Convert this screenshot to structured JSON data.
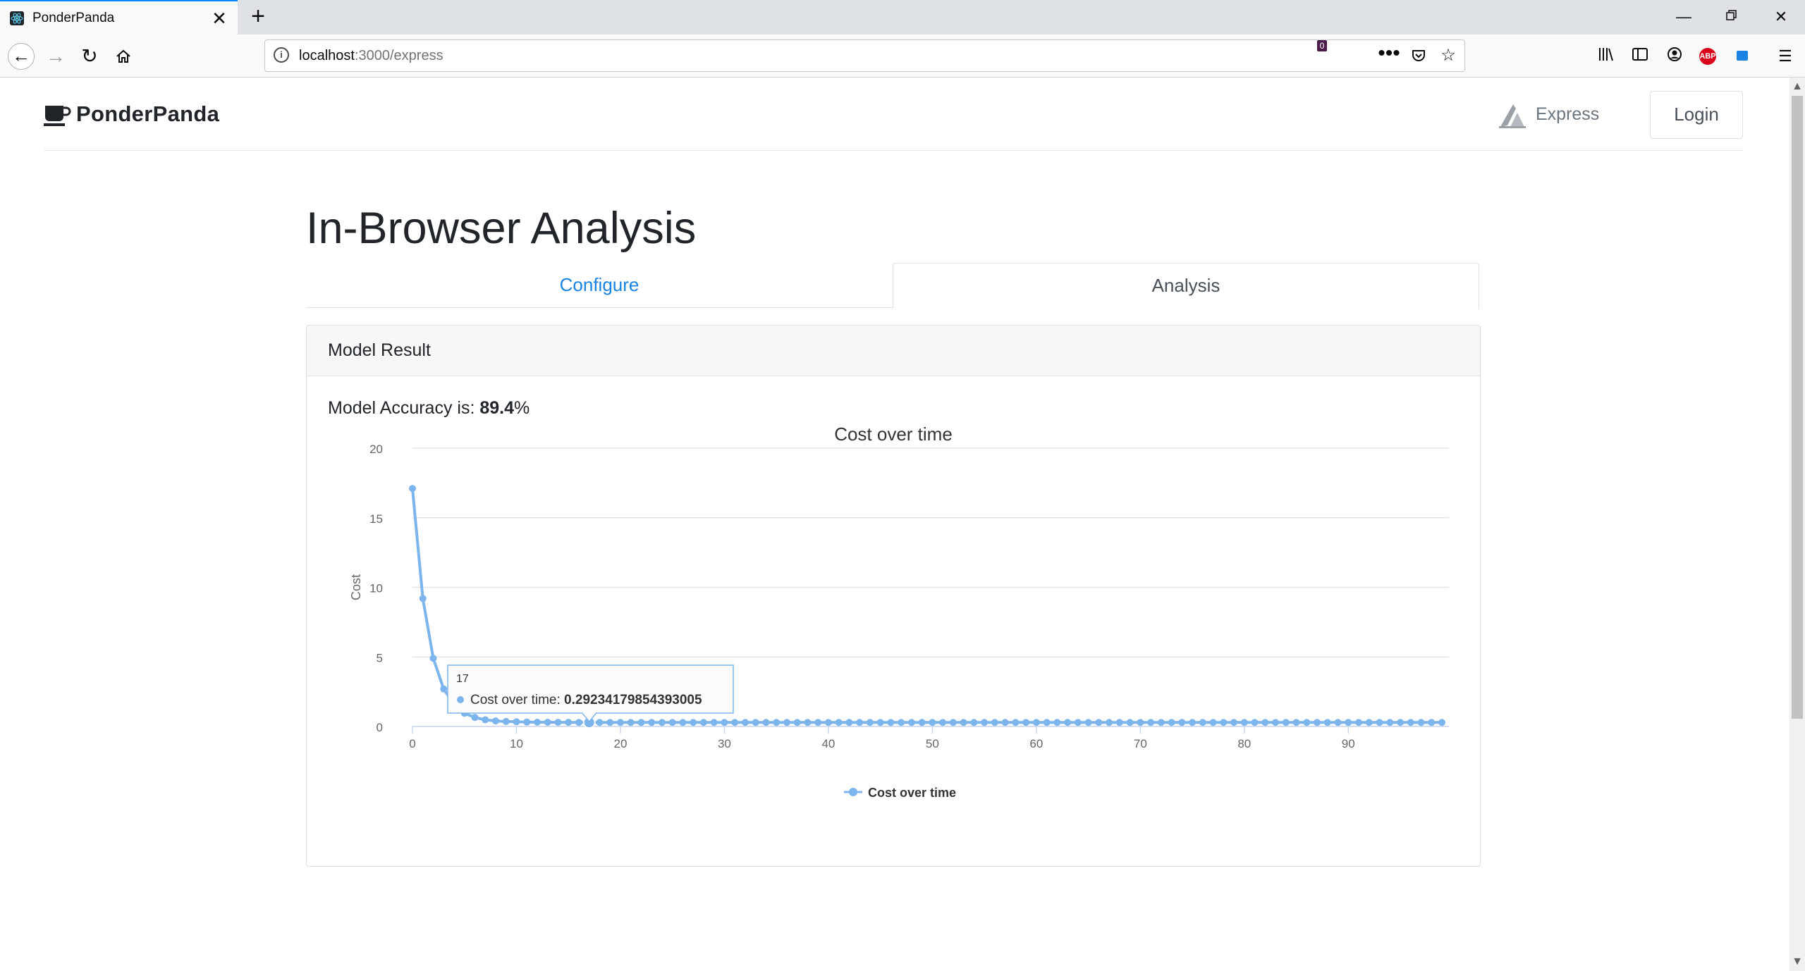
{
  "browser": {
    "tab_title": "PonderPanda",
    "url_host": "localhost",
    "url_path": ":3000/express",
    "extension_badge": "0",
    "abp_label": "ABP"
  },
  "site": {
    "brand": "PonderPanda",
    "nav_express": "Express",
    "nav_login": "Login"
  },
  "page": {
    "title": "In-Browser Analysis",
    "tabs": [
      {
        "label": "Configure",
        "active": false
      },
      {
        "label": "Analysis",
        "active": true
      }
    ],
    "card_header": "Model Result",
    "accuracy_prefix": "Model Accuracy is: ",
    "accuracy_value": "89.4",
    "accuracy_suffix": "%"
  },
  "tooltip": {
    "x": "17",
    "series": "Cost over time",
    "value": "0.29234179854393005"
  },
  "colors": {
    "series": "#7cb5ec",
    "link": "#1a82e2",
    "tab_accent": "#0a84ff"
  },
  "chart_data": {
    "type": "line",
    "title": "Cost over time",
    "xlabel": "",
    "ylabel": "Cost",
    "xlim": [
      0,
      99
    ],
    "ylim": [
      0,
      20
    ],
    "x_ticks": [
      0,
      10,
      20,
      30,
      40,
      50,
      60,
      70,
      80,
      90
    ],
    "y_ticks": [
      0,
      5,
      10,
      15,
      20
    ],
    "legend": "bottom-center",
    "grid": true,
    "series": [
      {
        "name": "Cost over time",
        "values": [
          17.1,
          9.2,
          4.9,
          2.7,
          1.6,
          0.95,
          0.65,
          0.48,
          0.4,
          0.36,
          0.34,
          0.32,
          0.31,
          0.305,
          0.3,
          0.297,
          0.294,
          0.29234179854393005,
          0.291,
          0.29,
          0.29,
          0.29,
          0.29,
          0.29,
          0.29,
          0.29,
          0.29,
          0.29,
          0.29,
          0.29,
          0.29,
          0.29,
          0.29,
          0.29,
          0.29,
          0.29,
          0.29,
          0.29,
          0.29,
          0.29,
          0.29,
          0.29,
          0.29,
          0.29,
          0.29,
          0.29,
          0.29,
          0.29,
          0.29,
          0.29,
          0.29,
          0.29,
          0.29,
          0.29,
          0.29,
          0.29,
          0.29,
          0.29,
          0.29,
          0.29,
          0.29,
          0.29,
          0.29,
          0.29,
          0.29,
          0.29,
          0.29,
          0.29,
          0.29,
          0.29,
          0.29,
          0.29,
          0.29,
          0.29,
          0.29,
          0.29,
          0.29,
          0.29,
          0.29,
          0.29,
          0.29,
          0.29,
          0.29,
          0.29,
          0.29,
          0.29,
          0.29,
          0.29,
          0.29,
          0.29,
          0.29,
          0.29,
          0.29,
          0.29,
          0.29,
          0.29,
          0.29,
          0.29,
          0.29,
          0.29
        ]
      }
    ],
    "highlight_index": 17
  }
}
